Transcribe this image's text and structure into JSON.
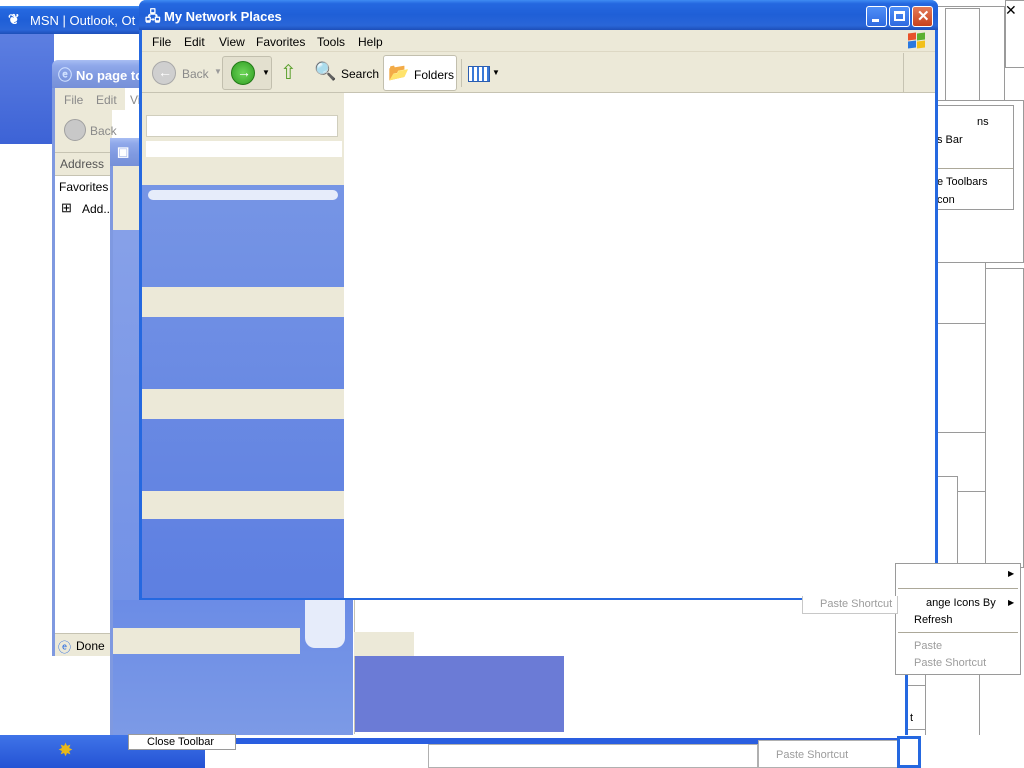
{
  "main_window": {
    "title": "My Network Places",
    "menus": [
      "File",
      "Edit",
      "View",
      "Favorites",
      "Tools",
      "Help"
    ],
    "toolbar": {
      "back_label": "Back",
      "search_label": "Search",
      "folders_label": "Folders"
    }
  },
  "msn_window": {
    "title": "MSN | Outlook, Ot"
  },
  "ie_window": {
    "title": "No page to",
    "menus": [
      "File",
      "Edit",
      "Vi"
    ],
    "back_label": "Back",
    "address_label": "Address",
    "favorites_label": "Favorites",
    "add_label": "Add...",
    "status_text": "Done"
  },
  "context_menu": {
    "arrange_icons_label": "ange Icons By",
    "refresh_label": "Refresh",
    "paste_label": "Paste",
    "paste_shortcut_label": "Paste Shortcut",
    "paste_shortcut_ghost": "Paste Shortcut"
  },
  "fragment_menu": {
    "line1": "ns",
    "line2": "s Bar",
    "line3": "e Toolbars",
    "line4": "con"
  },
  "taskbar": {
    "close_toolbar_label": "Close Toolbar",
    "ghost_text": "Paste Shortcut"
  },
  "fragments": {
    "t": "t"
  },
  "colors": {
    "xp_blue": "#2568e0",
    "panel_beige": "#ece9d8",
    "taskpane_blue": "#6b8ce6",
    "taskbar_blue": "#2a5ee0"
  }
}
